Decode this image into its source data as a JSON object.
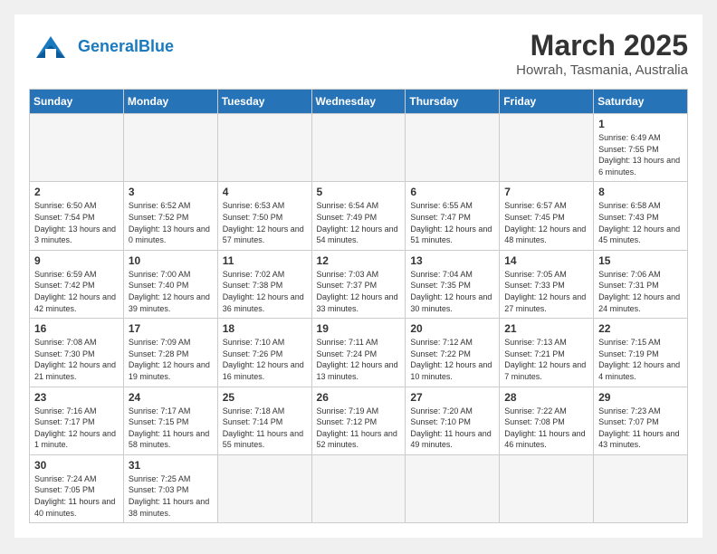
{
  "header": {
    "logo_text_general": "General",
    "logo_text_blue": "Blue",
    "month": "March 2025",
    "location": "Howrah, Tasmania, Australia"
  },
  "weekdays": [
    "Sunday",
    "Monday",
    "Tuesday",
    "Wednesday",
    "Thursday",
    "Friday",
    "Saturday"
  ],
  "weeks": [
    [
      {
        "day": "",
        "empty": true
      },
      {
        "day": "",
        "empty": true
      },
      {
        "day": "",
        "empty": true
      },
      {
        "day": "",
        "empty": true
      },
      {
        "day": "",
        "empty": true
      },
      {
        "day": "",
        "empty": true
      },
      {
        "day": "1",
        "sunrise": "6:49 AM",
        "sunset": "7:55 PM",
        "daylight": "13 hours and 6 minutes."
      }
    ],
    [
      {
        "day": "2",
        "sunrise": "6:50 AM",
        "sunset": "7:54 PM",
        "daylight": "13 hours and 3 minutes."
      },
      {
        "day": "3",
        "sunrise": "6:52 AM",
        "sunset": "7:52 PM",
        "daylight": "13 hours and 0 minutes."
      },
      {
        "day": "4",
        "sunrise": "6:53 AM",
        "sunset": "7:50 PM",
        "daylight": "12 hours and 57 minutes."
      },
      {
        "day": "5",
        "sunrise": "6:54 AM",
        "sunset": "7:49 PM",
        "daylight": "12 hours and 54 minutes."
      },
      {
        "day": "6",
        "sunrise": "6:55 AM",
        "sunset": "7:47 PM",
        "daylight": "12 hours and 51 minutes."
      },
      {
        "day": "7",
        "sunrise": "6:57 AM",
        "sunset": "7:45 PM",
        "daylight": "12 hours and 48 minutes."
      },
      {
        "day": "8",
        "sunrise": "6:58 AM",
        "sunset": "7:43 PM",
        "daylight": "12 hours and 45 minutes."
      }
    ],
    [
      {
        "day": "9",
        "sunrise": "6:59 AM",
        "sunset": "7:42 PM",
        "daylight": "12 hours and 42 minutes."
      },
      {
        "day": "10",
        "sunrise": "7:00 AM",
        "sunset": "7:40 PM",
        "daylight": "12 hours and 39 minutes."
      },
      {
        "day": "11",
        "sunrise": "7:02 AM",
        "sunset": "7:38 PM",
        "daylight": "12 hours and 36 minutes."
      },
      {
        "day": "12",
        "sunrise": "7:03 AM",
        "sunset": "7:37 PM",
        "daylight": "12 hours and 33 minutes."
      },
      {
        "day": "13",
        "sunrise": "7:04 AM",
        "sunset": "7:35 PM",
        "daylight": "12 hours and 30 minutes."
      },
      {
        "day": "14",
        "sunrise": "7:05 AM",
        "sunset": "7:33 PM",
        "daylight": "12 hours and 27 minutes."
      },
      {
        "day": "15",
        "sunrise": "7:06 AM",
        "sunset": "7:31 PM",
        "daylight": "12 hours and 24 minutes."
      }
    ],
    [
      {
        "day": "16",
        "sunrise": "7:08 AM",
        "sunset": "7:30 PM",
        "daylight": "12 hours and 21 minutes."
      },
      {
        "day": "17",
        "sunrise": "7:09 AM",
        "sunset": "7:28 PM",
        "daylight": "12 hours and 19 minutes."
      },
      {
        "day": "18",
        "sunrise": "7:10 AM",
        "sunset": "7:26 PM",
        "daylight": "12 hours and 16 minutes."
      },
      {
        "day": "19",
        "sunrise": "7:11 AM",
        "sunset": "7:24 PM",
        "daylight": "12 hours and 13 minutes."
      },
      {
        "day": "20",
        "sunrise": "7:12 AM",
        "sunset": "7:22 PM",
        "daylight": "12 hours and 10 minutes."
      },
      {
        "day": "21",
        "sunrise": "7:13 AM",
        "sunset": "7:21 PM",
        "daylight": "12 hours and 7 minutes."
      },
      {
        "day": "22",
        "sunrise": "7:15 AM",
        "sunset": "7:19 PM",
        "daylight": "12 hours and 4 minutes."
      }
    ],
    [
      {
        "day": "23",
        "sunrise": "7:16 AM",
        "sunset": "7:17 PM",
        "daylight": "12 hours and 1 minute."
      },
      {
        "day": "24",
        "sunrise": "7:17 AM",
        "sunset": "7:15 PM",
        "daylight": "11 hours and 58 minutes."
      },
      {
        "day": "25",
        "sunrise": "7:18 AM",
        "sunset": "7:14 PM",
        "daylight": "11 hours and 55 minutes."
      },
      {
        "day": "26",
        "sunrise": "7:19 AM",
        "sunset": "7:12 PM",
        "daylight": "11 hours and 52 minutes."
      },
      {
        "day": "27",
        "sunrise": "7:20 AM",
        "sunset": "7:10 PM",
        "daylight": "11 hours and 49 minutes."
      },
      {
        "day": "28",
        "sunrise": "7:22 AM",
        "sunset": "7:08 PM",
        "daylight": "11 hours and 46 minutes."
      },
      {
        "day": "29",
        "sunrise": "7:23 AM",
        "sunset": "7:07 PM",
        "daylight": "11 hours and 43 minutes."
      }
    ],
    [
      {
        "day": "30",
        "sunrise": "7:24 AM",
        "sunset": "7:05 PM",
        "daylight": "11 hours and 40 minutes."
      },
      {
        "day": "31",
        "sunrise": "7:25 AM",
        "sunset": "7:03 PM",
        "daylight": "11 hours and 38 minutes."
      },
      {
        "day": "",
        "empty": true
      },
      {
        "day": "",
        "empty": true
      },
      {
        "day": "",
        "empty": true
      },
      {
        "day": "",
        "empty": true
      },
      {
        "day": "",
        "empty": true
      }
    ]
  ],
  "labels": {
    "sunrise": "Sunrise:",
    "sunset": "Sunset:",
    "daylight": "Daylight:"
  }
}
